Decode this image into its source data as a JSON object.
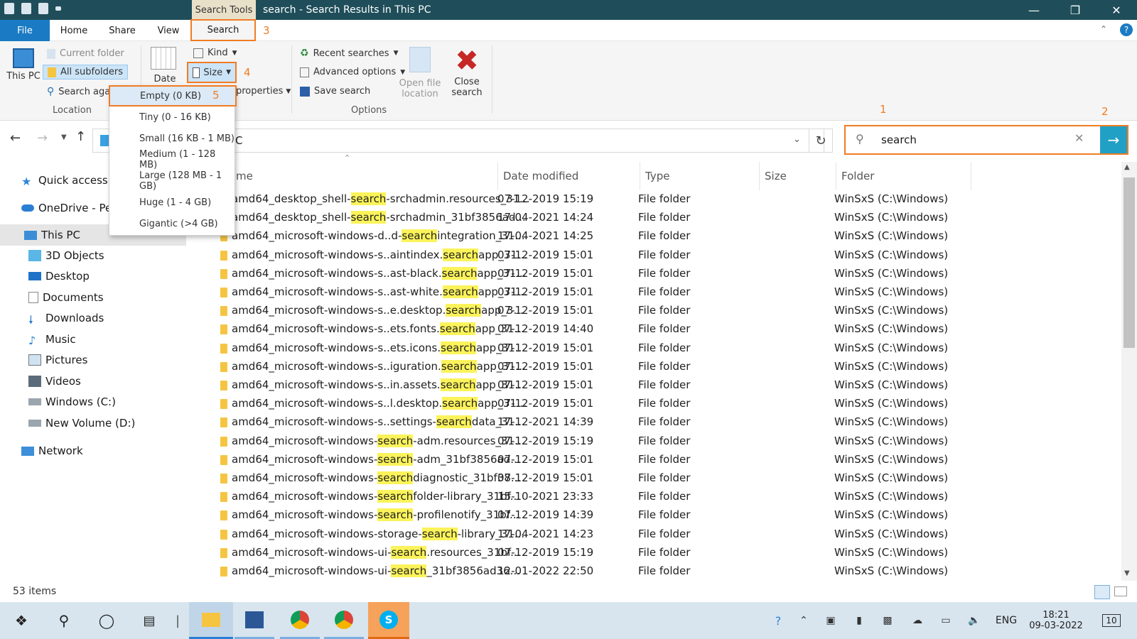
{
  "window": {
    "title": "search - Search Results in This PC",
    "context_tab": "Search Tools"
  },
  "ribbon_tabs": [
    "File",
    "Home",
    "Share",
    "View",
    "Search"
  ],
  "ribbon": {
    "location": {
      "this_pc": "This PC",
      "current_folder": "Current folder",
      "all_subfolders": "All subfolders",
      "search_again": "Search agai",
      "group": "Location"
    },
    "refine": {
      "date": "Date",
      "kind": "Kind",
      "size": "Size",
      "properties": "properties"
    },
    "options": {
      "recent_searches": "Recent searches",
      "advanced_options": "Advanced options",
      "save_search": "Save search",
      "open_file_location": "Open file location",
      "close_search": "Close search",
      "group": "Options"
    }
  },
  "size_menu": [
    "Empty (0 KB)",
    "Tiny (0 - 16 KB)",
    "Small (16 KB - 1 MB)",
    "Medium (1 - 128 MB)",
    "Large (128 MB - 1 GB)",
    "Huge (1 - 4 GB)",
    "Gigantic (>4 GB)"
  ],
  "annotations": [
    "1",
    "2",
    "3",
    "4",
    "5"
  ],
  "address": {
    "text": "C"
  },
  "search": {
    "query": "search"
  },
  "nav": {
    "quick_access": "Quick access",
    "onedrive": "OneDrive - Pers",
    "this_pc": "This PC",
    "items": [
      "3D Objects",
      "Desktop",
      "Documents",
      "Downloads",
      "Music",
      "Pictures",
      "Videos",
      "Windows (C:)",
      "New Volume (D:)"
    ],
    "network": "Network"
  },
  "columns": [
    "me",
    "Date modified",
    "Type",
    "Size",
    "Folder"
  ],
  "rows": [
    {
      "pre": "amd64_desktop_shell-",
      "hl": "search",
      "post": "-srchadmin.resources_31...",
      "date": "07-12-2019 15:19",
      "type": "File folder",
      "folder": "WinSxS (C:\\Windows)"
    },
    {
      "pre": "amd64_desktop_shell-",
      "hl": "search",
      "post": "-srchadmin_31bf3856ad...",
      "date": "17-04-2021 14:24",
      "type": "File folder",
      "folder": "WinSxS (C:\\Windows)"
    },
    {
      "pre": "amd64_microsoft-windows-d..d-",
      "hl": "search",
      "post": "integration_31...",
      "date": "17-04-2021 14:25",
      "type": "File folder",
      "folder": "WinSxS (C:\\Windows)"
    },
    {
      "pre": "amd64_microsoft-windows-s..aintindex.",
      "hl": "search",
      "post": "app_31...",
      "date": "07-12-2019 15:01",
      "type": "File folder",
      "folder": "WinSxS (C:\\Windows)"
    },
    {
      "pre": "amd64_microsoft-windows-s..ast-black.",
      "hl": "search",
      "post": "app_31...",
      "date": "07-12-2019 15:01",
      "type": "File folder",
      "folder": "WinSxS (C:\\Windows)"
    },
    {
      "pre": "amd64_microsoft-windows-s..ast-white.",
      "hl": "search",
      "post": "app_31...",
      "date": "07-12-2019 15:01",
      "type": "File folder",
      "folder": "WinSxS (C:\\Windows)"
    },
    {
      "pre": "amd64_microsoft-windows-s..e.desktop.",
      "hl": "search",
      "post": "app_3...",
      "date": "07-12-2019 15:01",
      "type": "File folder",
      "folder": "WinSxS (C:\\Windows)"
    },
    {
      "pre": "amd64_microsoft-windows-s..ets.fonts.",
      "hl": "search",
      "post": "app_31...",
      "date": "07-12-2019 14:40",
      "type": "File folder",
      "folder": "WinSxS (C:\\Windows)"
    },
    {
      "pre": "amd64_microsoft-windows-s..ets.icons.",
      "hl": "search",
      "post": "app_31...",
      "date": "07-12-2019 15:01",
      "type": "File folder",
      "folder": "WinSxS (C:\\Windows)"
    },
    {
      "pre": "amd64_microsoft-windows-s..iguration.",
      "hl": "search",
      "post": "app_31...",
      "date": "07-12-2019 15:01",
      "type": "File folder",
      "folder": "WinSxS (C:\\Windows)"
    },
    {
      "pre": "amd64_microsoft-windows-s..in.assets.",
      "hl": "search",
      "post": "app_31...",
      "date": "07-12-2019 15:01",
      "type": "File folder",
      "folder": "WinSxS (C:\\Windows)"
    },
    {
      "pre": "amd64_microsoft-windows-s..l.desktop.",
      "hl": "search",
      "post": "app_31...",
      "date": "07-12-2019 15:01",
      "type": "File folder",
      "folder": "WinSxS (C:\\Windows)"
    },
    {
      "pre": "amd64_microsoft-windows-s..settings-",
      "hl": "search",
      "post": "data_31...",
      "date": "17-12-2021 14:39",
      "type": "File folder",
      "folder": "WinSxS (C:\\Windows)"
    },
    {
      "pre": "amd64_microsoft-windows-",
      "hl": "search",
      "post": "-adm.resources_31...",
      "date": "07-12-2019 15:19",
      "type": "File folder",
      "folder": "WinSxS (C:\\Windows)"
    },
    {
      "pre": "amd64_microsoft-windows-",
      "hl": "search",
      "post": "-adm_31bf3856ad...",
      "date": "07-12-2019 15:01",
      "type": "File folder",
      "folder": "WinSxS (C:\\Windows)"
    },
    {
      "pre": "amd64_microsoft-windows-",
      "hl": "search",
      "post": "diagnostic_31bf38...",
      "date": "07-12-2019 15:01",
      "type": "File folder",
      "folder": "WinSxS (C:\\Windows)"
    },
    {
      "pre": "amd64_microsoft-windows-",
      "hl": "search",
      "post": "folder-library_31bf...",
      "date": "15-10-2021 23:33",
      "type": "File folder",
      "folder": "WinSxS (C:\\Windows)"
    },
    {
      "pre": "amd64_microsoft-windows-",
      "hl": "search",
      "post": "-profilenotify_31bf...",
      "date": "07-12-2019 14:39",
      "type": "File folder",
      "folder": "WinSxS (C:\\Windows)"
    },
    {
      "pre": "amd64_microsoft-windows-storage-",
      "hl": "search",
      "post": "-library_31...",
      "date": "17-04-2021 14:23",
      "type": "File folder",
      "folder": "WinSxS (C:\\Windows)"
    },
    {
      "pre": "amd64_microsoft-windows-ui-",
      "hl": "search",
      "post": ".resources_31bf...",
      "date": "07-12-2019 15:19",
      "type": "File folder",
      "folder": "WinSxS (C:\\Windows)"
    },
    {
      "pre": "amd64_microsoft-windows-ui-",
      "hl": "search",
      "post": "_31bf3856ad36...",
      "date": "12-01-2022 22:50",
      "type": "File folder",
      "folder": "WinSxS (C:\\Windows)"
    }
  ],
  "status": {
    "count": "53 items"
  },
  "tray": {
    "lang": "ENG",
    "time": "18:21",
    "date": "09-03-2022",
    "notif": "10"
  },
  "colors": {
    "accent": "#f07c24",
    "titlebar": "#1f4e5a",
    "file_tab": "#1a7bc4",
    "search_go": "#21a0c5",
    "highlight": "#fbf35a"
  }
}
